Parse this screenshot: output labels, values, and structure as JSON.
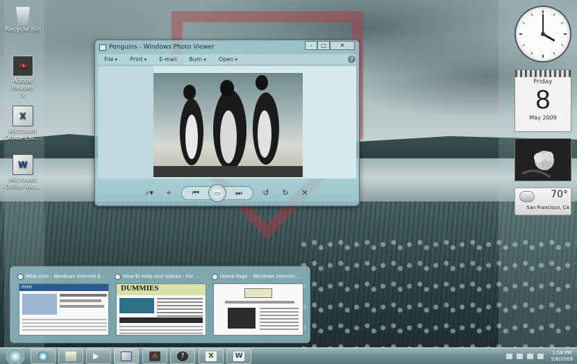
{
  "desktop": {
    "icons": [
      {
        "label_lines": [
          "Recycle Bin"
        ],
        "icon": "recycle-bin-icon"
      },
      {
        "label_lines": [
          "Adobe Reader",
          "9"
        ],
        "icon": "adobe-reader-icon"
      },
      {
        "label_lines": [
          "Microsoft",
          "Office Exc..."
        ],
        "icon": "excel-icon"
      },
      {
        "label_lines": [
          "Microsoft",
          "Office Wo..."
        ],
        "icon": "word-icon"
      }
    ]
  },
  "photo_viewer": {
    "title": "Penguins - Windows Photo Viewer",
    "menu": [
      "File",
      "Print",
      "E-mail",
      "Burn",
      "Open"
    ],
    "controls": [
      "zoom-icon",
      "fit-icon",
      "previous-icon",
      "slideshow-icon",
      "next-icon",
      "rotate-ccw-icon",
      "rotate-cw-icon",
      "delete-icon"
    ]
  },
  "gadgets": {
    "clock": {
      "hour": 4,
      "minute": 0
    },
    "calendar": {
      "weekday": "Friday",
      "day": "8",
      "month_year": "May 2009"
    },
    "weather": {
      "temperature": "70°",
      "city": "San Francisco, CA"
    }
  },
  "thumbnails": [
    {
      "title": "MSN.com - Windows Internet E...",
      "brand": "msn"
    },
    {
      "title": "How-To Help and Videos - For ...",
      "brand": "DUMMIES"
    },
    {
      "title": "Home Page - Windows Internet ...",
      "brand": ""
    }
  ],
  "taskbar": {
    "buttons": [
      "internet-explorer-icon",
      "windows-explorer-icon",
      "media-player-icon",
      "photo-viewer-icon",
      "adobe-reader-icon",
      "help-icon",
      "excel-icon",
      "word-icon"
    ],
    "time": "1:58 PM",
    "date": "5/8/2009"
  },
  "colors": {
    "accent": "#5a787d",
    "watermark": "#b23a45"
  }
}
